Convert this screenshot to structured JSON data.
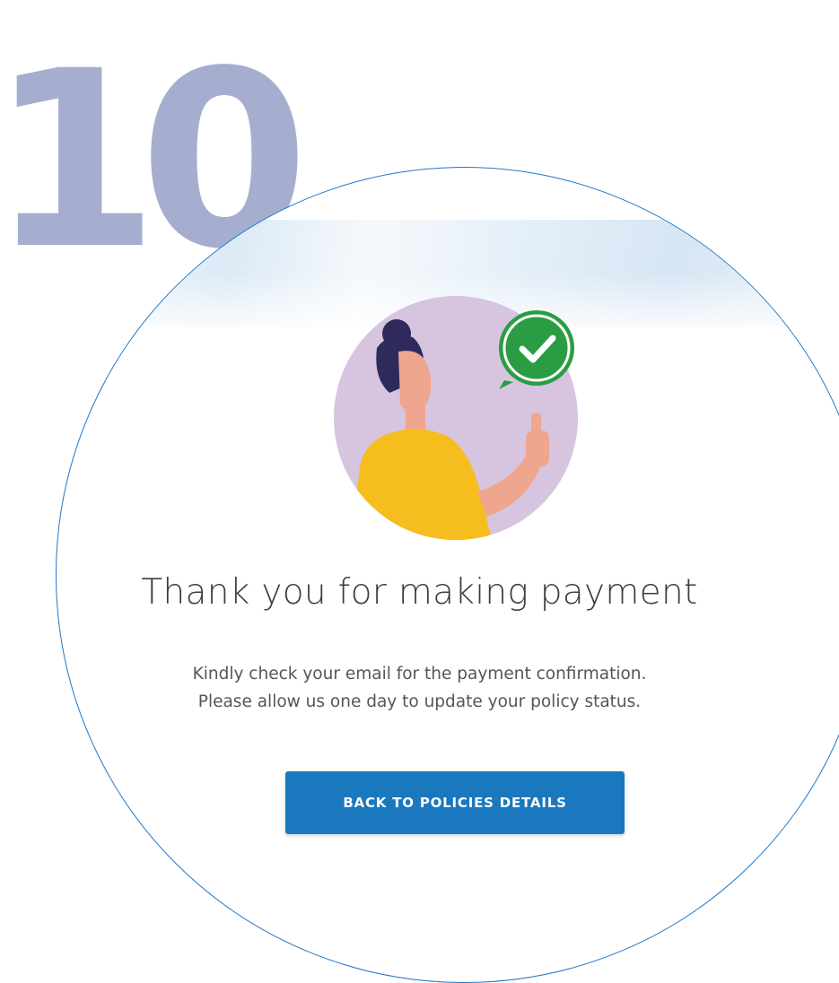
{
  "step": {
    "number": "10"
  },
  "confirmation": {
    "title": "Thank you for making payment",
    "message_lines": [
      "Kindly check your email for the payment confirmation.",
      "Please allow us one day to update your policy status."
    ],
    "button_label": "BACK TO POLICIES DETAILS"
  },
  "illustration": {
    "person": "woman-thumbs-up",
    "badge_icon": "checkmark-icon"
  },
  "colors": {
    "accent": "#1a78bf",
    "step_number": "#a6aecf",
    "illustration_bg": "#d7c4df",
    "badge": "#2a9d44",
    "shirt": "#f5bd1e"
  }
}
